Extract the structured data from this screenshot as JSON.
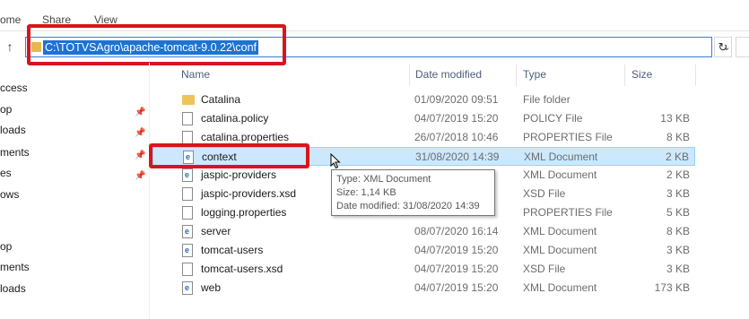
{
  "ribbon": {
    "tabs": [
      "ome",
      "Share",
      "View"
    ]
  },
  "address_bar": {
    "path": "C:\\TOTVSAgro\\apache-tomcat-9.0.22\\conf",
    "up_icon": "up-arrow-icon",
    "dropdown_icon": "chevron-down-icon",
    "refresh_icon": "refresh-icon"
  },
  "nav_pane": {
    "items": [
      {
        "label": "ccess",
        "pinned": false
      },
      {
        "label": "op",
        "pinned": true
      },
      {
        "label": "loads",
        "pinned": true
      },
      {
        "label": "ments",
        "pinned": true
      },
      {
        "label": "es",
        "pinned": true
      },
      {
        "label": "ows",
        "pinned": false
      },
      {
        "label": "",
        "pinned": false
      },
      {
        "label": "op",
        "pinned": false
      },
      {
        "label": "ments",
        "pinned": false
      },
      {
        "label": "loads",
        "pinned": false
      },
      {
        "label": "",
        "pinned": false
      }
    ]
  },
  "columns": {
    "name": "Name",
    "date": "Date modified",
    "type": "Type",
    "size": "Size"
  },
  "files": [
    {
      "name": "Catalina",
      "date": "01/09/2020 09:51",
      "type": "File folder",
      "size": "",
      "icon": "folder"
    },
    {
      "name": "catalina.policy",
      "date": "04/07/2019 15:20",
      "type": "POLICY File",
      "size": "13 KB",
      "icon": "file"
    },
    {
      "name": "catalina.properties",
      "date": "26/07/2018 10:46",
      "type": "PROPERTIES File",
      "size": "8 KB",
      "icon": "file"
    },
    {
      "name": "context",
      "date": "31/08/2020 14:39",
      "type": "XML Document",
      "size": "2 KB",
      "icon": "xml",
      "selected": true
    },
    {
      "name": "jaspic-providers",
      "date": "",
      "type": "XML Document",
      "size": "2 KB",
      "icon": "xml"
    },
    {
      "name": "jaspic-providers.xsd",
      "date": "",
      "type": "XSD File",
      "size": "3 KB",
      "icon": "file"
    },
    {
      "name": "logging.properties",
      "date": "",
      "type": "PROPERTIES File",
      "size": "5 KB",
      "icon": "file"
    },
    {
      "name": "server",
      "date": "08/07/2020 16:14",
      "type": "XML Document",
      "size": "8 KB",
      "icon": "xml"
    },
    {
      "name": "tomcat-users",
      "date": "04/07/2019 15:20",
      "type": "XML Document",
      "size": "3 KB",
      "icon": "xml"
    },
    {
      "name": "tomcat-users.xsd",
      "date": "04/07/2019 15:20",
      "type": "XSD File",
      "size": "3 KB",
      "icon": "file"
    },
    {
      "name": "web",
      "date": "04/07/2019 15:20",
      "type": "XML Document",
      "size": "173 KB",
      "icon": "xml"
    }
  ],
  "tooltip": {
    "line1": "Type: XML Document",
    "line2": "Size: 1,14 KB",
    "line3": "Date modified: 31/08/2020 14:39"
  },
  "colors": {
    "highlight": "#d9151b",
    "selection_bg": "#cce8ff",
    "address_selection": "#1e73d2"
  }
}
